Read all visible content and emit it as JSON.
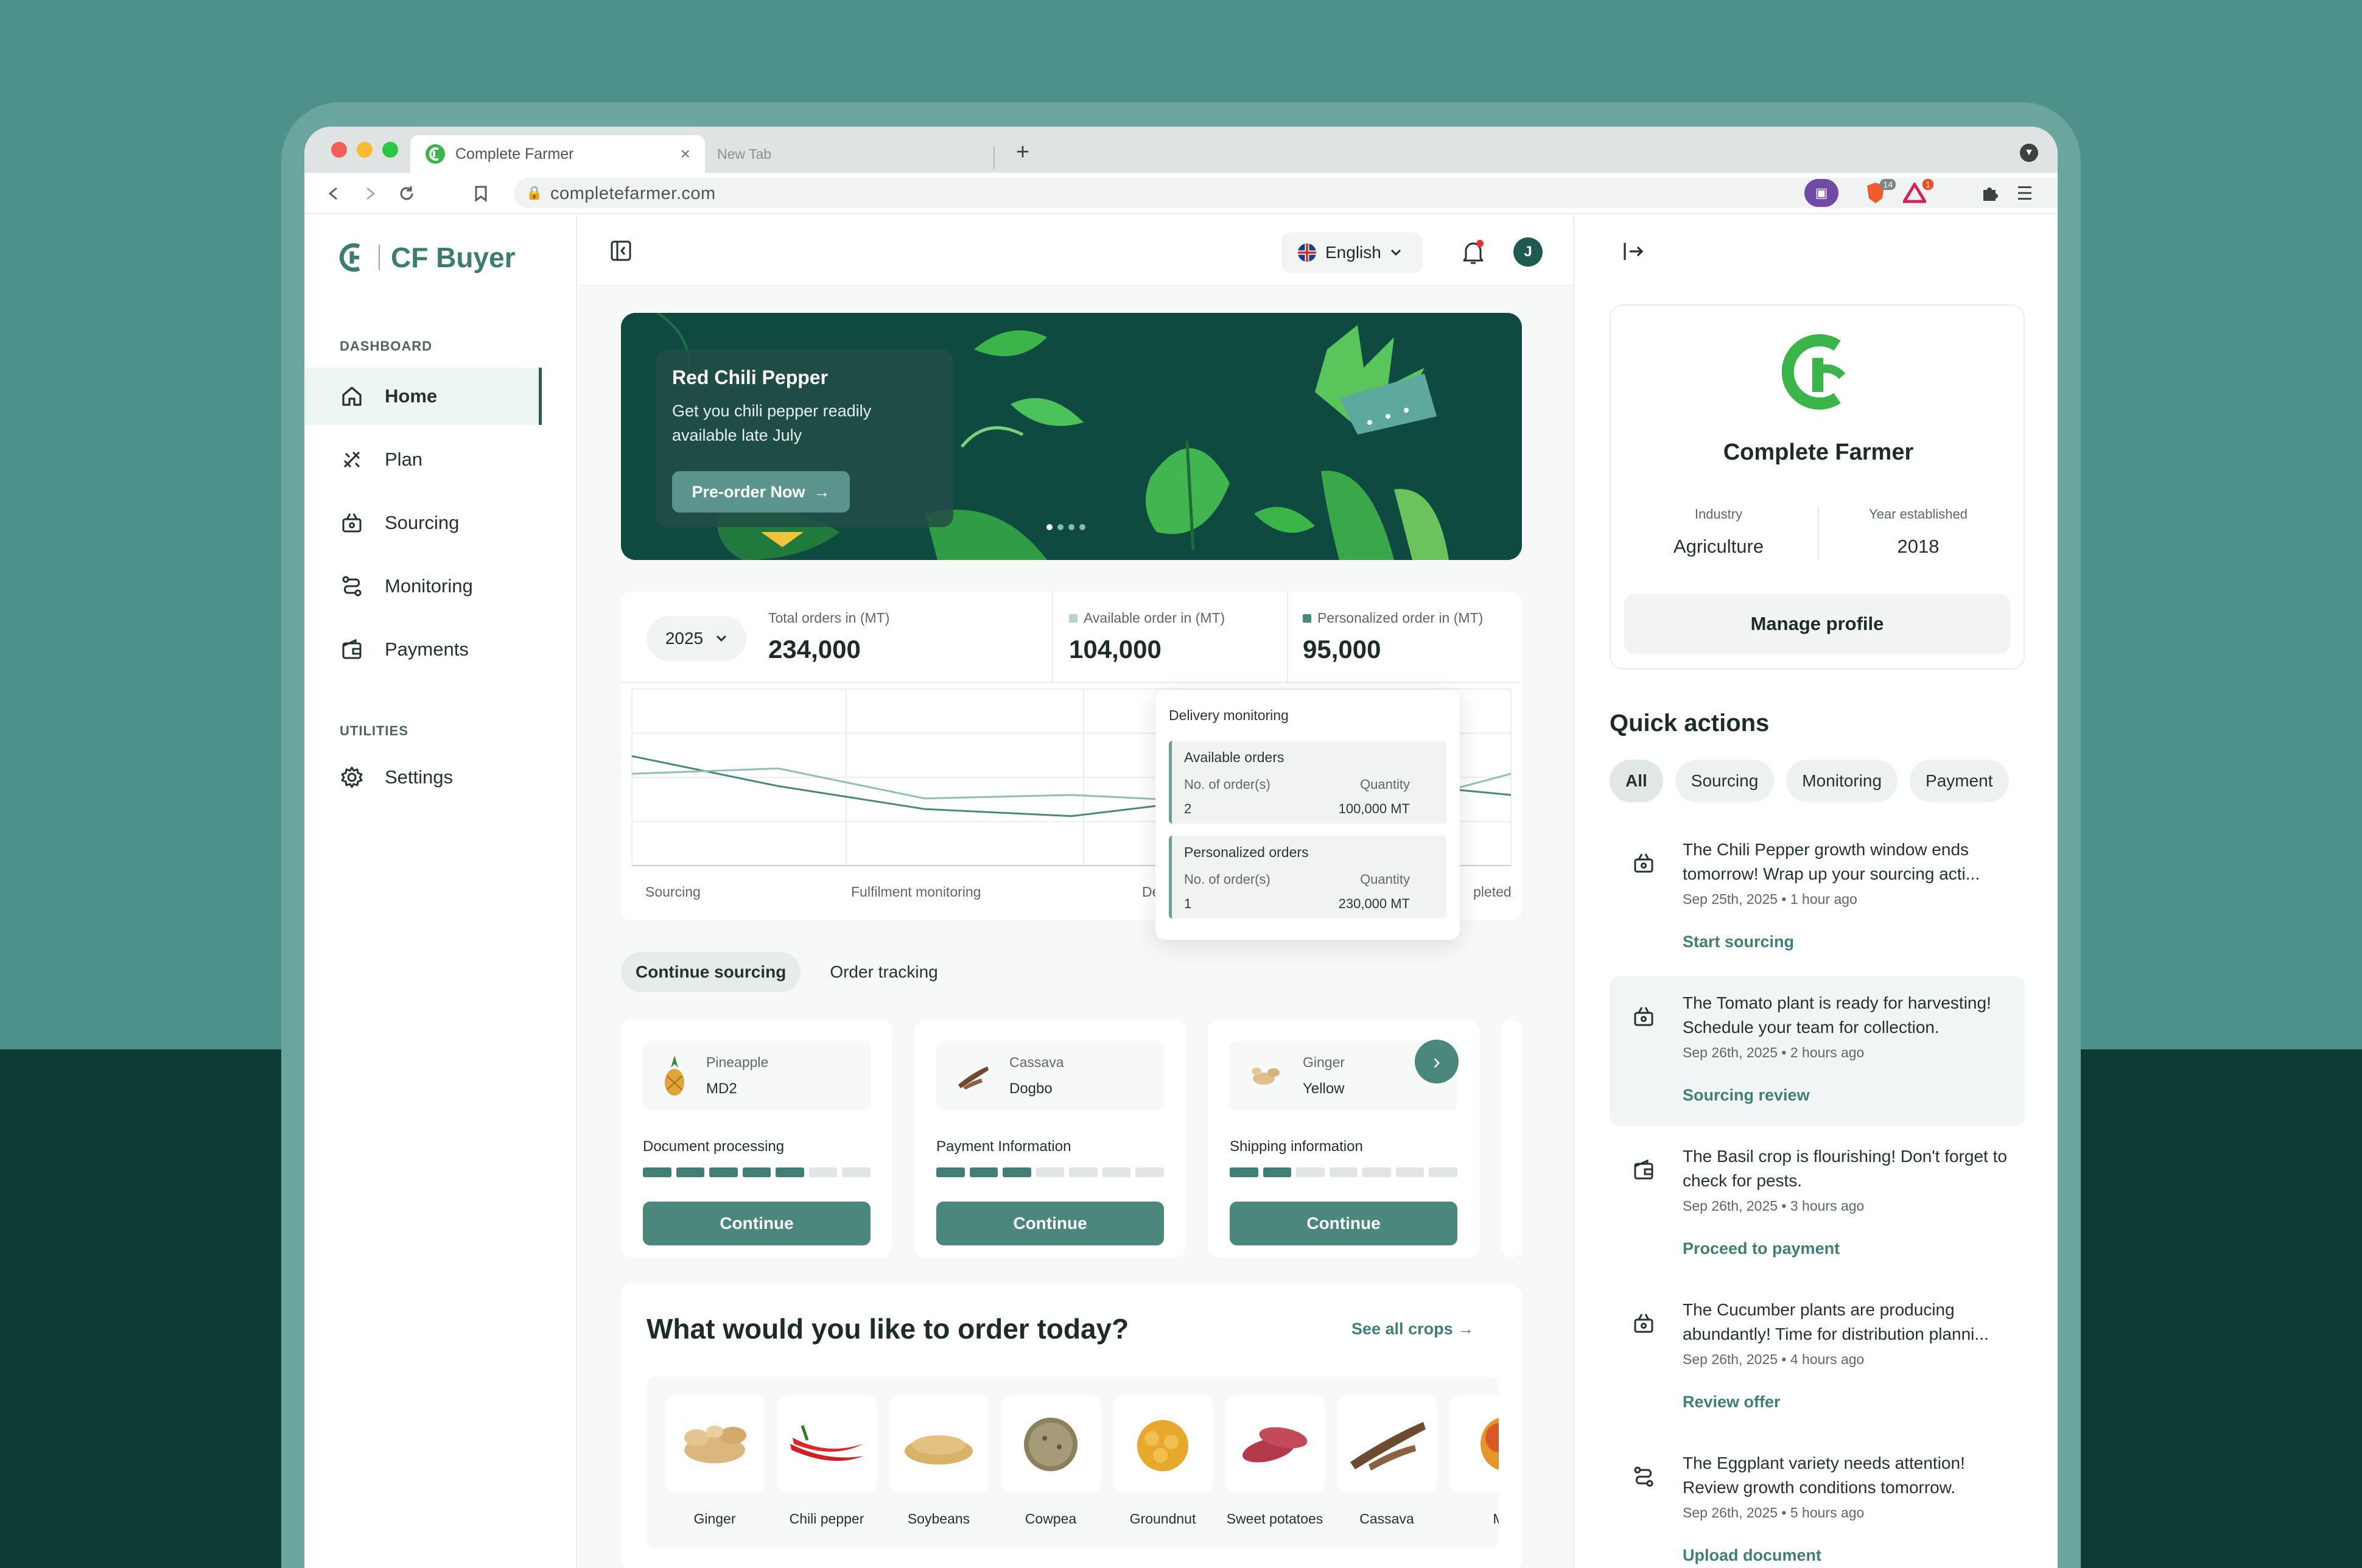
{
  "browser": {
    "tab_active": "Complete Farmer",
    "tab_new": "New Tab",
    "url": "completefarmer.com",
    "badge_count_1": "14",
    "badge_count_2": "1"
  },
  "sidebar": {
    "app_name": "CF Buyer",
    "section_dashboard": "DASHBOARD",
    "section_utilities": "UTILITIES",
    "items": [
      {
        "label": "Home",
        "icon": "home-icon"
      },
      {
        "label": "Plan",
        "icon": "tools-icon"
      },
      {
        "label": "Sourcing",
        "icon": "basket-icon"
      },
      {
        "label": "Monitoring",
        "icon": "route-icon"
      },
      {
        "label": "Payments",
        "icon": "wallet-icon"
      },
      {
        "label": "Settings",
        "icon": "gear-icon"
      }
    ]
  },
  "topbar": {
    "language": "English",
    "avatar_initial": "J"
  },
  "banner": {
    "title": "Red Chili Pepper",
    "text": "Get you chili pepper readily available late July",
    "button": "Pre-order Now",
    "slide_dots": 4,
    "active_dot": 1
  },
  "stats": {
    "year": "2025",
    "total_label": "Total orders in (MT)",
    "total_value": "234,000",
    "available_label": "Available order in (MT)",
    "available_value": "104,000",
    "personalized_label": "Personalized order in (MT)",
    "personalized_value": "95,000"
  },
  "chart_data": {
    "type": "line",
    "categories": [
      "Sourcing",
      "Fulfilment monitoring",
      "De",
      "pleted"
    ],
    "series": [
      {
        "values": [
          0.62,
          0.45,
          0.32,
          0.28,
          0.38,
          0.48,
          0.4
        ]
      },
      {
        "values": [
          0.52,
          0.55,
          0.38,
          0.4,
          0.36,
          0.3,
          0.52
        ]
      }
    ],
    "grid": true
  },
  "tooltip": {
    "title": "Delivery monitoring",
    "available_title": "Available orders",
    "available_count_label": "No. of order(s)",
    "available_qty_label": "Quantity",
    "available_count": "2",
    "available_qty": "100,000 MT",
    "personalized_title": "Personalized orders",
    "personalized_count_label": "No. of order(s)",
    "personalized_qty_label": "Quantity",
    "personalized_count": "1",
    "personalized_qty": "230,000 MT"
  },
  "content_tabs": {
    "active": "Continue sourcing",
    "other": "Order tracking"
  },
  "cards": [
    {
      "crop": "Pineapple",
      "variety": "MD2",
      "step": "Document processing",
      "progress": 0.714,
      "button": "Continue"
    },
    {
      "crop": "Cassava",
      "variety": "Dogbo",
      "step": "Payment Information",
      "progress": 0.429,
      "button": "Continue"
    },
    {
      "crop": "Ginger",
      "variety": "Yellow",
      "step": "Shipping information",
      "progress": 0.286,
      "button": "Continue"
    }
  ],
  "order_section": {
    "title": "What would you like to order today?",
    "see_all": "See all crops",
    "crops": [
      "Ginger",
      "Chili pepper",
      "Soybeans",
      "Cowpea",
      "Groundnut",
      "Sweet potatoes",
      "Cassava",
      "M"
    ]
  },
  "profile": {
    "name": "Complete Farmer",
    "industry_label": "Industry",
    "industry": "Agriculture",
    "year_label": "Year established",
    "year": "2018",
    "button": "Manage profile"
  },
  "quick_actions": {
    "title": "Quick actions",
    "filters": [
      "All",
      "Sourcing",
      "Monitoring",
      "Payment"
    ],
    "items": [
      {
        "text": "The Chili Pepper growth window ends tomorrow! Wrap up your sourcing acti...",
        "meta": "Sep 25th, 2025 • 1 hour ago",
        "link": "Start sourcing"
      },
      {
        "text": "The Tomato plant is ready for harvesting! Schedule your team for collection.",
        "meta": "Sep 26th, 2025 • 2 hours ago",
        "link": "Sourcing review"
      },
      {
        "text": "The Basil crop is flourishing! Don't forget to check for pests.",
        "meta": "Sep 26th, 2025 • 3 hours ago",
        "link": "Proceed to payment"
      },
      {
        "text": "The Cucumber plants are producing abundantly! Time for distribution planni...",
        "meta": "Sep 26th, 2025 • 4 hours ago",
        "link": "Review offer"
      },
      {
        "text": "The Eggplant variety needs attention! Review growth conditions tomorrow.",
        "meta": "Sep 26th, 2025 • 5 hours ago",
        "link": "Upload document"
      }
    ]
  },
  "colors": {
    "accent": "#3f7f75",
    "brand_green": "#3bb54a",
    "background": "#4e918a",
    "dark": "#0e3b33"
  }
}
